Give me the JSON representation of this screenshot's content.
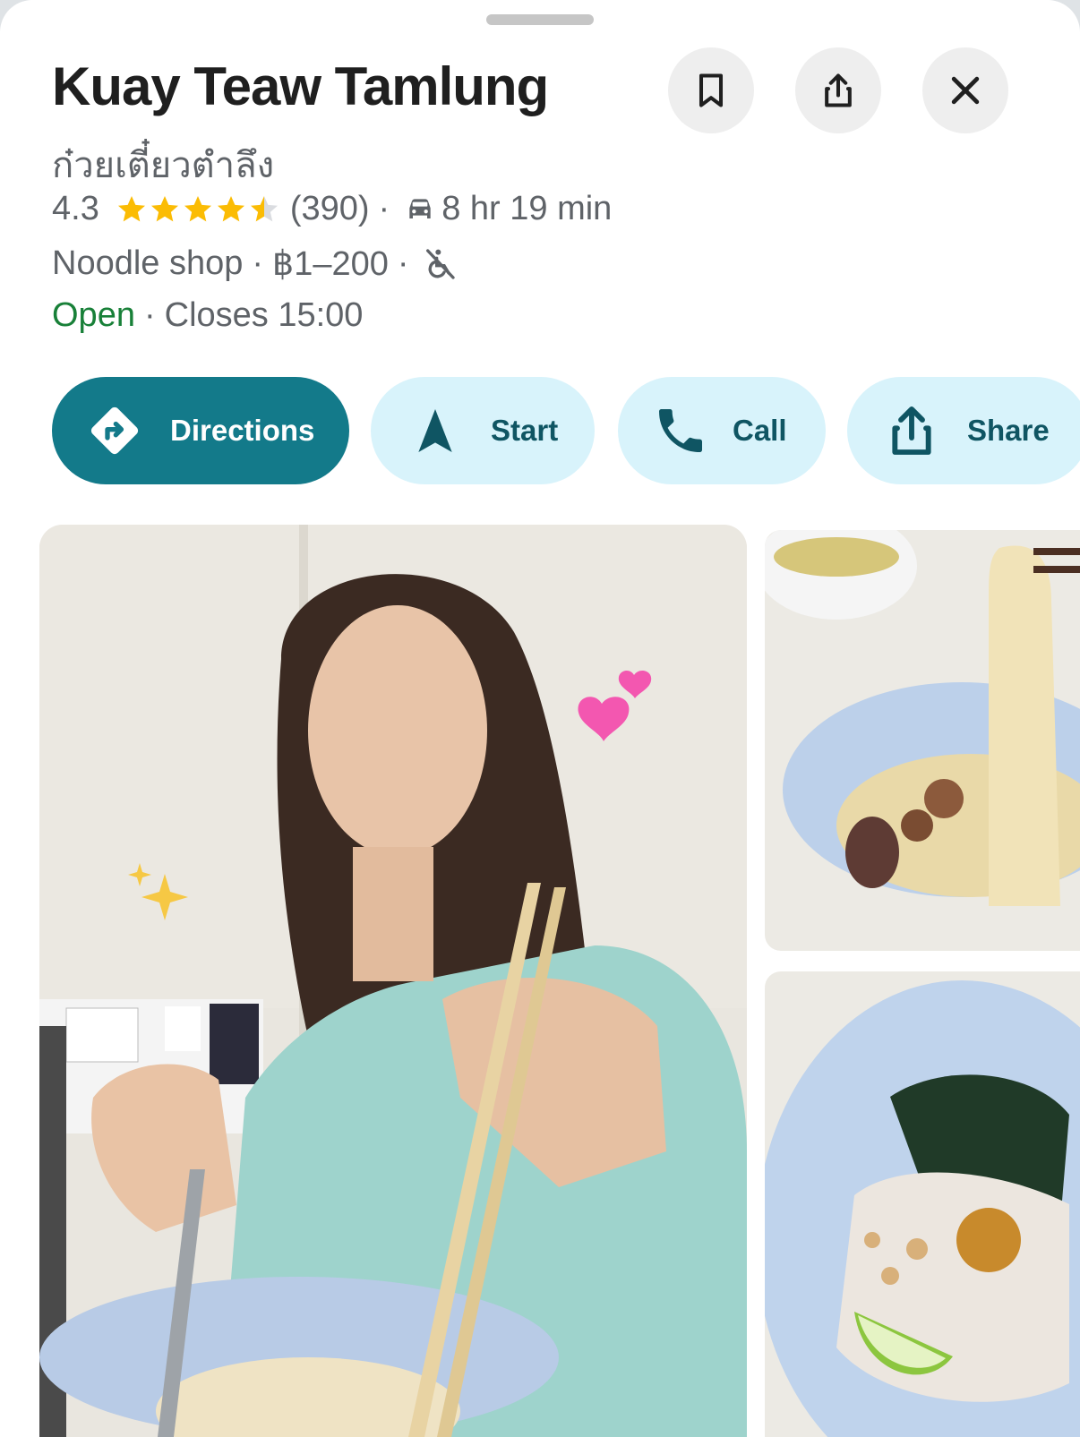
{
  "place": {
    "name": "Kuay Teaw Tamlung",
    "thai_name": "ก๋วยเตี๋ยวตำลึง",
    "rating": "4.3",
    "stars": 4.5,
    "reviews": "(390)",
    "drive_time": "8 hr 19 min",
    "category": "Noodle shop",
    "price": "฿1–200",
    "status": "Open",
    "hours": "Closes 15:00"
  },
  "header_buttons": {
    "save_icon": "bookmark-icon",
    "share_icon": "share-upload-icon",
    "close_icon": "close-icon"
  },
  "actions": [
    {
      "label": "Directions",
      "icon": "directions-icon"
    },
    {
      "label": "Start",
      "icon": "navigation-arrow-icon"
    },
    {
      "label": "Call",
      "icon": "phone-icon"
    },
    {
      "label": "Share",
      "icon": "share-upload-icon"
    }
  ],
  "colors": {
    "primary": "#137a8a",
    "pill": "#d8f3fb",
    "star": "#fbbc04",
    "open": "#188038"
  }
}
